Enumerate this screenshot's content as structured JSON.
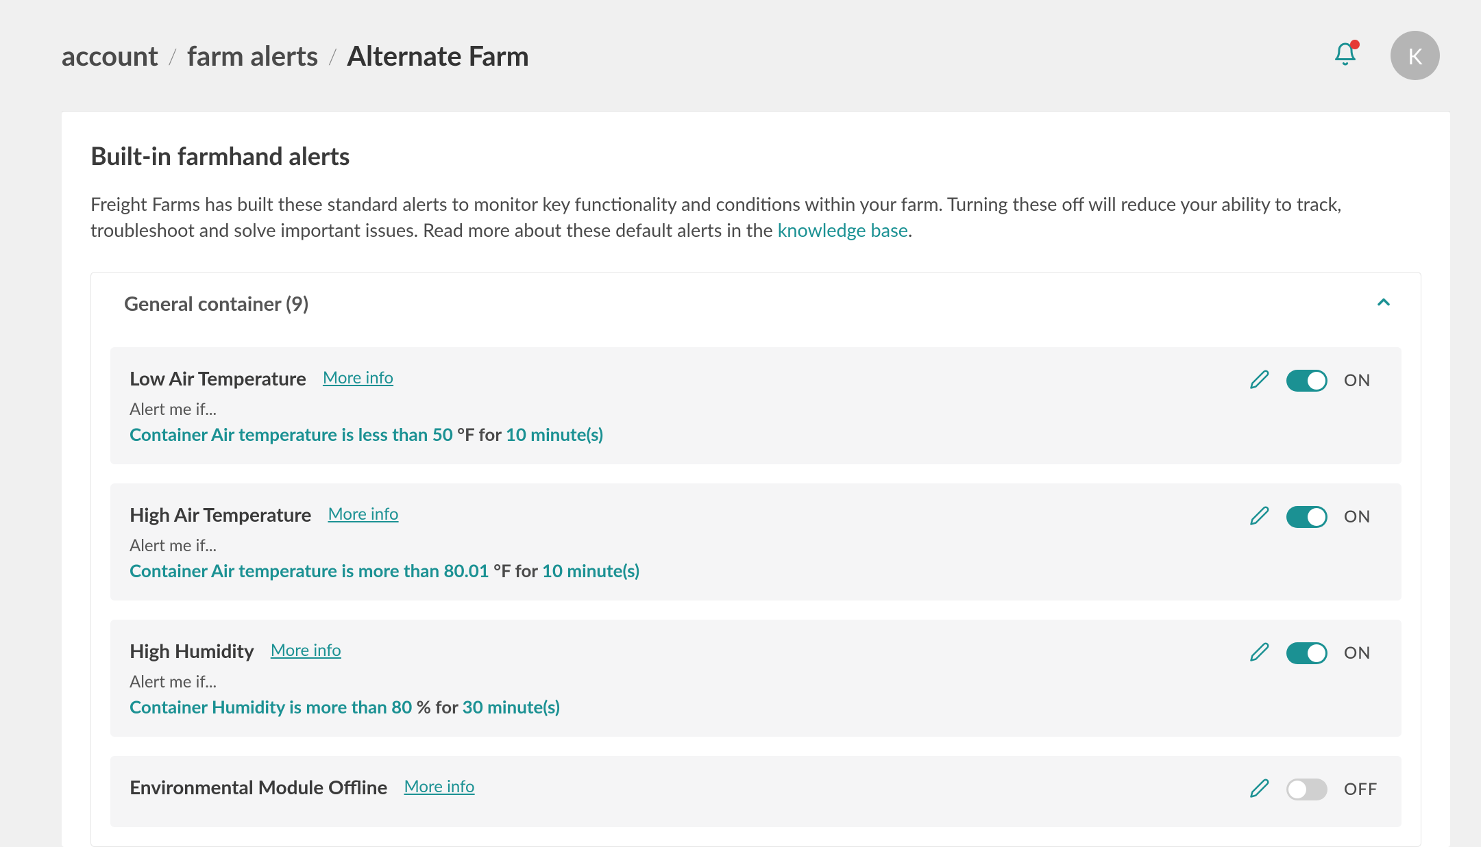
{
  "breadcrumb": {
    "level1": "account",
    "level2": "farm alerts",
    "level3": "Alternate Farm"
  },
  "header": {
    "avatar_initial": "K"
  },
  "section": {
    "title": "Built-in farmhand alerts",
    "description_pre": "Freight Farms has built these standard alerts to monitor key functionality and conditions within your farm. Turning these off will reduce your ability to track, troubleshoot and solve important issues. Read more about these default alerts in the ",
    "description_link": "knowledge base",
    "description_post": "."
  },
  "accordion": {
    "title": "General container (9)"
  },
  "labels": {
    "more_info": "More info",
    "alert_me_if": "Alert me if...",
    "on": "ON",
    "off": "OFF"
  },
  "alerts": [
    {
      "title": "Low Air Temperature",
      "condition_parts": [
        {
          "text": "Container Air temperature is less than 50",
          "accent": true
        },
        {
          "text": " °F for ",
          "accent": false
        },
        {
          "text": "10 minute(s)",
          "accent": true
        }
      ],
      "enabled": true
    },
    {
      "title": "High Air Temperature",
      "condition_parts": [
        {
          "text": "Container Air temperature is more than 80.01",
          "accent": true
        },
        {
          "text": " °F for ",
          "accent": false
        },
        {
          "text": "10 minute(s)",
          "accent": true
        }
      ],
      "enabled": true
    },
    {
      "title": "High Humidity",
      "condition_parts": [
        {
          "text": "Container Humidity is more than 80",
          "accent": true
        },
        {
          "text": " % for ",
          "accent": false
        },
        {
          "text": "30 minute(s)",
          "accent": true
        }
      ],
      "enabled": true
    },
    {
      "title": "Environmental Module Offline",
      "condition_parts": [],
      "enabled": false
    }
  ]
}
